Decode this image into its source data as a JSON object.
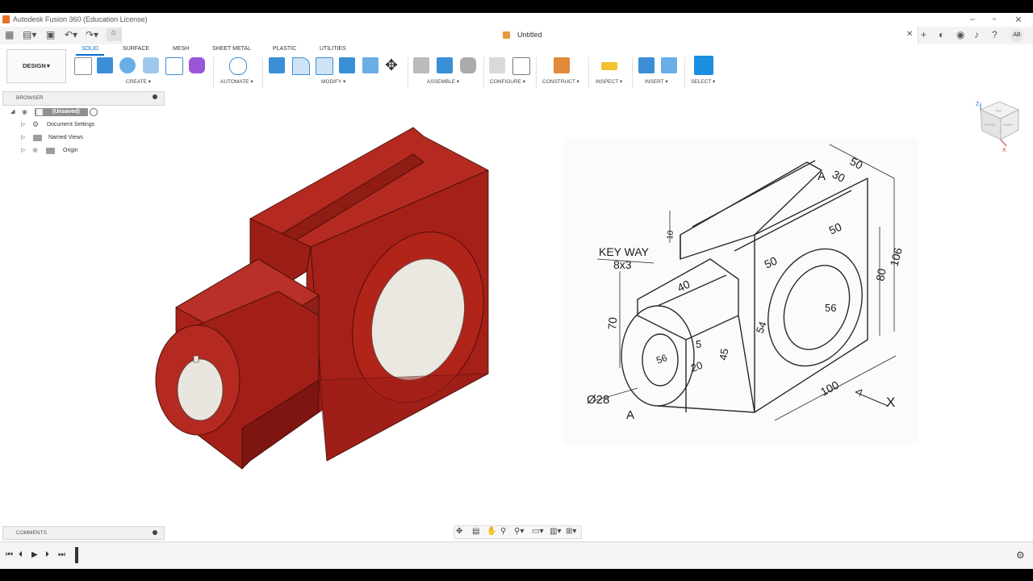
{
  "app": {
    "window_title": "Autodesk Fusion 360 (Education License)",
    "document_title": "Untitled",
    "user_initials": "AB"
  },
  "ribbon": {
    "workspace": "DESIGN",
    "tabs": [
      "SOLID",
      "SURFACE",
      "MESH",
      "SHEET METAL",
      "PLASTIC",
      "UTILITIES"
    ],
    "groups": [
      "CREATE",
      "AUTOMATE",
      "MODIFY",
      "ASSEMBLE",
      "CONFIGURE",
      "CONSTRUCT",
      "INSPECT",
      "INSERT",
      "SELECT"
    ]
  },
  "browser": {
    "title": "BROWSER",
    "root": "(Unsaved)",
    "items": [
      "Document Settings",
      "Named Views",
      "Origin"
    ]
  },
  "comments": {
    "title": "COMMENTS"
  },
  "viewcube": {
    "axis_z": "Z",
    "axis_x": "X",
    "face_top": "TOP",
    "face_front": "FRONT",
    "face_right": "RIGHT"
  },
  "drawing": {
    "keyway_title": "KEY WAY",
    "keyway_size": "8x3",
    "dims": [
      "50",
      "30",
      "50",
      "50",
      "106",
      "80",
      "10",
      "40",
      "70",
      "56",
      "5",
      "20",
      "45",
      "54",
      "100",
      "56"
    ],
    "diameter": "Ø28",
    "section_a_top": "A",
    "section_a_bottom": "A",
    "view_x": "X"
  },
  "colors": {
    "part": "#a9231c",
    "bore": "#ece9e4",
    "accent": "#0a6bd1"
  }
}
